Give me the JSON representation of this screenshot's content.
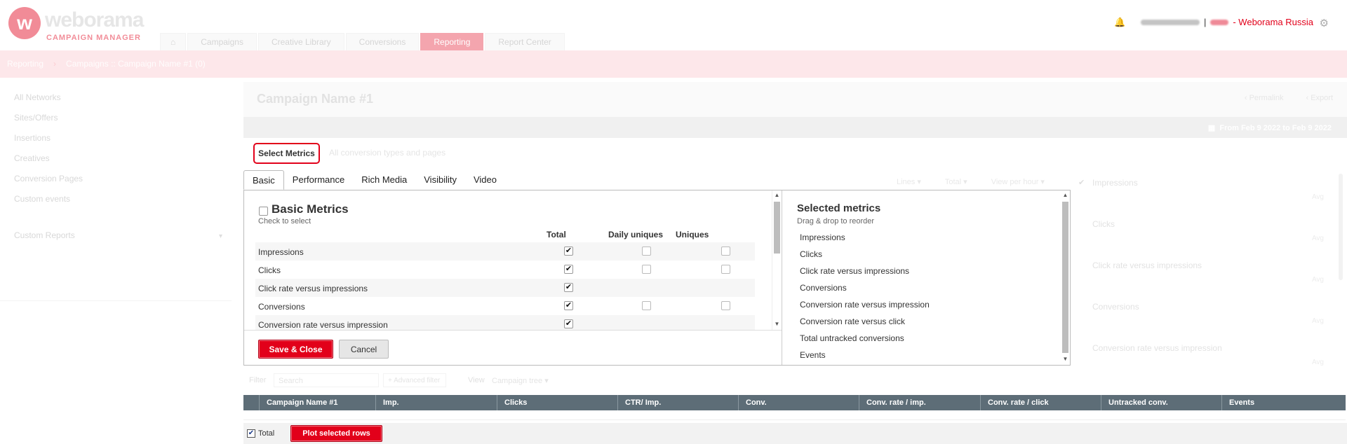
{
  "app": {
    "logo_letter": "w",
    "logo_name": "weborama",
    "logo_sub": "CAMPAIGN MANAGER",
    "nav_tabs": [
      "Campaigns",
      "Creative Library",
      "Conversions",
      "Reporting",
      "Report Center"
    ],
    "home_icon": "home-icon",
    "user_separator": "|",
    "organization": "- Weborama Russia",
    "accent_color": "#e2001a"
  },
  "breadcrumb": [
    "Reporting",
    "Campaigns :: Campaign Name #1 (0)"
  ],
  "sidebar": {
    "items": [
      "All Networks",
      "Sites/Offers",
      "Insertions",
      "Creatives",
      "Conversion Pages",
      "Custom events"
    ],
    "custom_reports": "Custom Reports"
  },
  "main": {
    "title": "Campaign Name #1",
    "links": [
      "Permalink",
      "Export"
    ],
    "date_range": "From Feb 9 2022 to Feb 9 2022",
    "conversion_types": "All conversion types and pages",
    "mini_columns": [
      "Lines",
      "Total",
      "View per hour"
    ]
  },
  "bg_right_panel": [
    {
      "label": "Impressions",
      "avg": "Avg"
    },
    {
      "label": "Clicks",
      "avg": "Avg"
    },
    {
      "label": "Click rate versus impressions",
      "avg": "Avg"
    },
    {
      "label": "Conversions",
      "avg": "Avg"
    },
    {
      "label": "Conversion rate versus impression",
      "avg": "Avg"
    }
  ],
  "filter": {
    "label": "Filter",
    "search_placeholder": "Search",
    "advanced": "+ Advanced filter",
    "view_label": "View",
    "view_value": "Campaign tree"
  },
  "table": {
    "columns": [
      "Campaign Name #1",
      "Imp.",
      "Clicks",
      "CTR/ Imp.",
      "Conv.",
      "Conv. rate / imp.",
      "Conv. rate / click",
      "Untracked conv.",
      "Events"
    ]
  },
  "footer": {
    "total_label": "Total",
    "plot_button": "Plot selected rows"
  },
  "metrics_modal": {
    "select_button": "Select Metrics",
    "tabs": [
      "Basic",
      "Performance",
      "Rich Media",
      "Visibility",
      "Video"
    ],
    "active_tab": "Basic",
    "basic": {
      "title": "Basic Metrics",
      "subtitle": "Check to select",
      "columns": [
        "Total",
        "Daily uniques",
        "Uniques"
      ],
      "rows": [
        {
          "name": "Impressions",
          "total": true,
          "daily": false,
          "uniques": false
        },
        {
          "name": "Clicks",
          "total": true,
          "daily": false,
          "uniques": false
        },
        {
          "name": "Click rate versus impressions",
          "total": true,
          "daily": null,
          "uniques": null
        },
        {
          "name": "Conversions",
          "total": true,
          "daily": false,
          "uniques": false
        },
        {
          "name": "Conversion rate versus impression",
          "total": true,
          "daily": null,
          "uniques": null
        }
      ]
    },
    "selected": {
      "title": "Selected metrics",
      "subtitle": "Drag & drop to reorder",
      "items": [
        "Impressions",
        "Clicks",
        "Click rate versus impressions",
        "Conversions",
        "Conversion rate versus impression",
        "Conversion rate versus click",
        "Total untracked conversions",
        "Events"
      ]
    },
    "save_button": "Save & Close",
    "cancel_button": "Cancel"
  }
}
